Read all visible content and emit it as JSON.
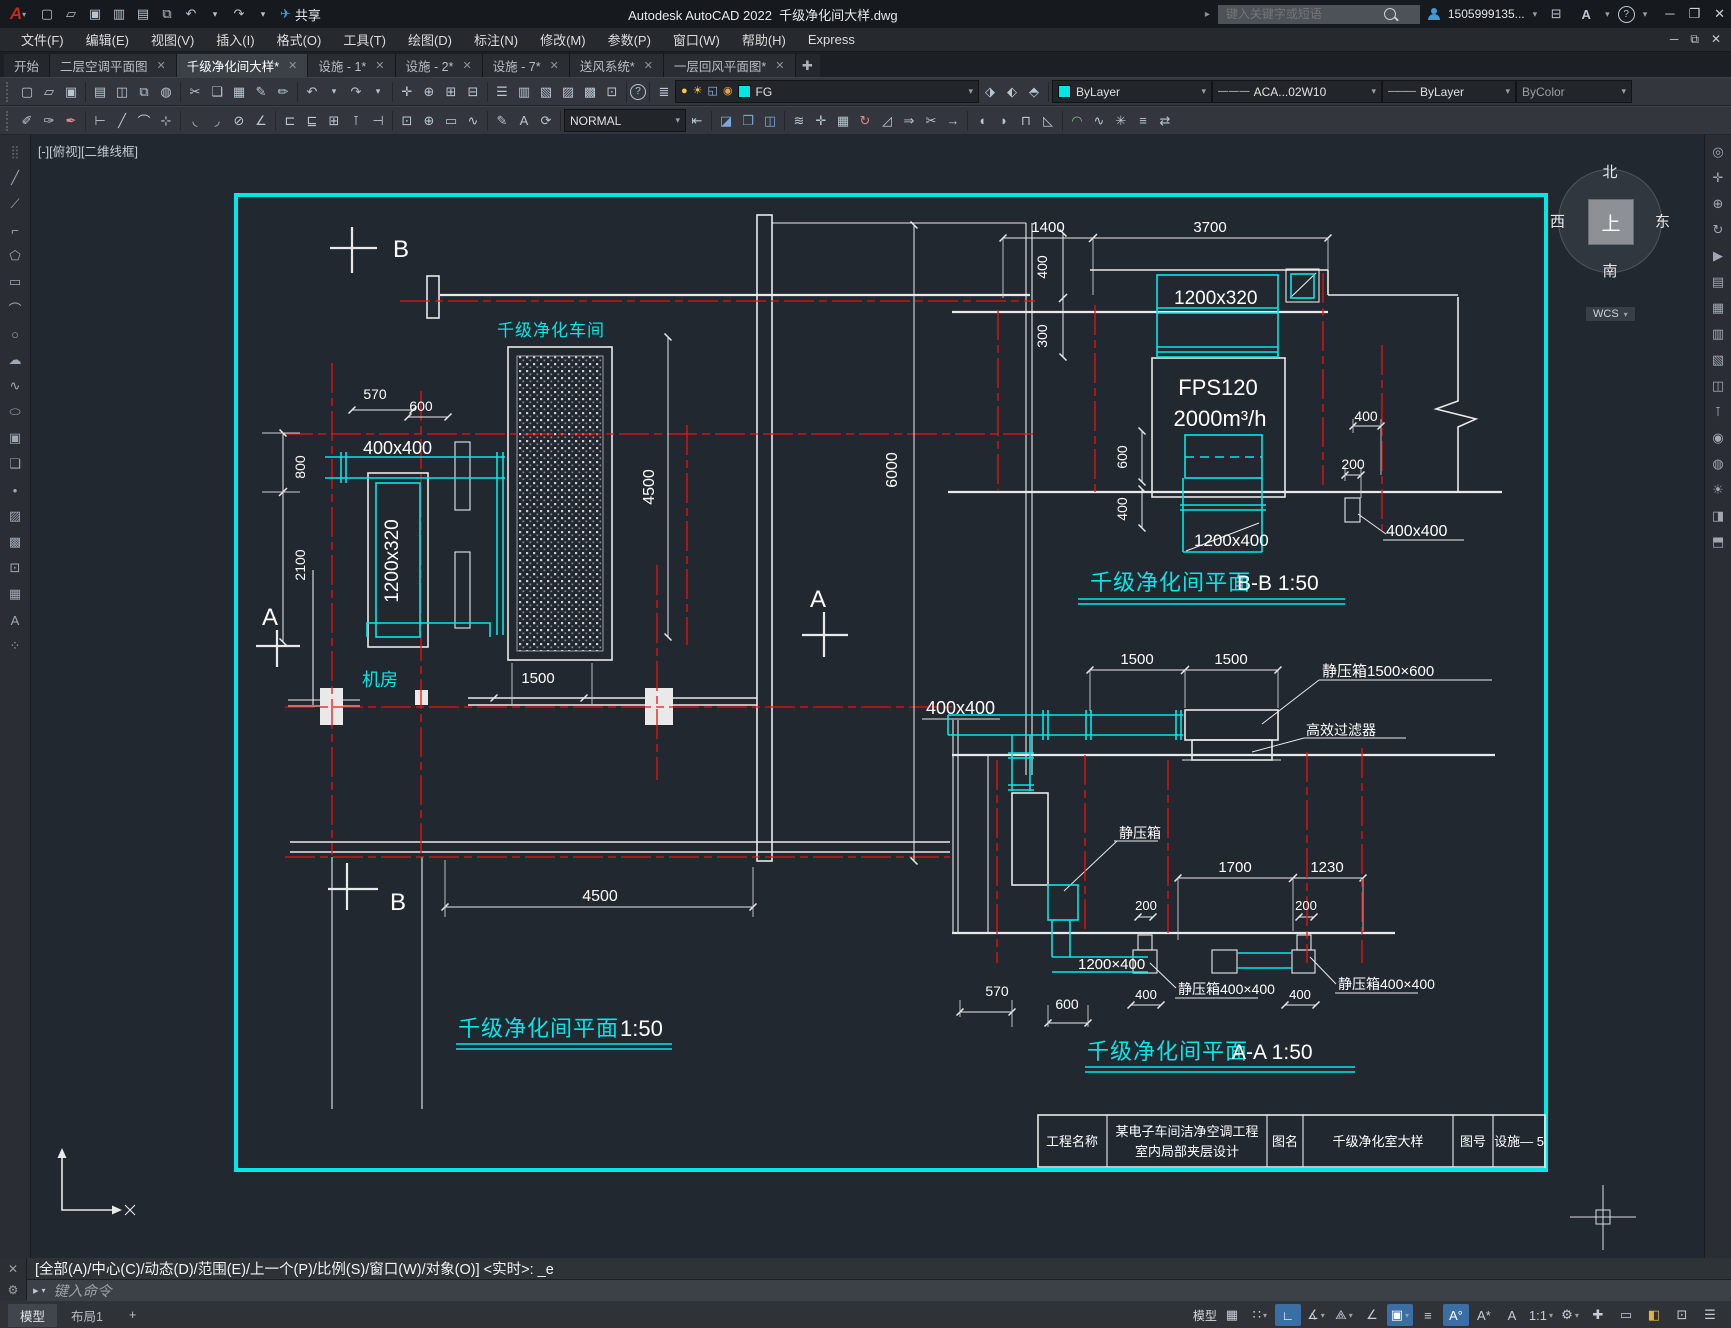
{
  "titlebar": {
    "app_title": "Autodesk AutoCAD 2022",
    "doc_title": "千级净化间大样.dwg",
    "share_label": "共享",
    "search_placeholder": "键入关键字或短语",
    "user_id": "1505999135..."
  },
  "menubar": {
    "items": [
      "文件(F)",
      "编辑(E)",
      "视图(V)",
      "插入(I)",
      "格式(O)",
      "工具(T)",
      "绘图(D)",
      "标注(N)",
      "修改(M)",
      "参数(P)",
      "窗口(W)",
      "帮助(H)",
      "Express"
    ]
  },
  "filetabs": {
    "tabs": [
      {
        "label": "开始"
      },
      {
        "label": "二层空调平面图"
      },
      {
        "label": "千级净化间大样*"
      },
      {
        "label": "设施 - 1*"
      },
      {
        "label": "设施 - 2*"
      },
      {
        "label": "设施 - 7*"
      },
      {
        "label": "送风系统*"
      },
      {
        "label": "一层回风平面图*"
      }
    ]
  },
  "ribbon": {
    "layer_name": "FG",
    "color": "ByLayer",
    "linetype": "ACA...02W10",
    "lineweight": "ByLayer",
    "plot_style": "ByColor",
    "dim_style": "NORMAL"
  },
  "icons": {
    "quick_access": [
      "qnew",
      "open",
      "save",
      "save-as",
      "plot",
      "undo",
      "redo",
      "share"
    ],
    "toolbar1": [
      "qnew",
      "open",
      "save",
      "plot",
      "plot-preview",
      "publish",
      "etransmit",
      "cut",
      "copy",
      "paste",
      "match-properties",
      "block-editor",
      "undo",
      "redo",
      "pan",
      "zoom-realtime",
      "zoom-window",
      "zoom-previous",
      "properties",
      "design-center",
      "tool-palettes",
      "sheet-set-manager",
      "markup-set-manager",
      "quickcalc",
      "help",
      "layer-properties",
      "layer-off",
      "layer-states",
      "layer-walk",
      "layer-bulb",
      "layer-sun",
      "layer-lock"
    ],
    "toolbar2": [
      "dim-update",
      "dim-style",
      "dim-override",
      "linear-dimension",
      "aligned-dimension",
      "arc-length-dimension",
      "ordinate-dimension",
      "radius-dimension",
      "diameter-dimension",
      "angular-dimension",
      "quick-dimension",
      "baseline-dimension",
      "continue-dimension",
      "dimension-break",
      "tolerance",
      "center-mark",
      "jogged-dimension",
      "dimension-edit",
      "dimension-text-edit",
      "erase",
      "copy",
      "mirror",
      "offset",
      "array",
      "move",
      "rotate",
      "scale",
      "stretch",
      "trim",
      "extend",
      "break",
      "join",
      "chamfer",
      "fillet",
      "explode",
      "align"
    ],
    "left_strip": [
      "line",
      "construction-line",
      "polyline",
      "polygon",
      "rectangle",
      "arc",
      "circle",
      "revision-cloud",
      "spline",
      "ellipse",
      "insert-block",
      "create-block",
      "point",
      "hatch",
      "gradient",
      "region",
      "table",
      "mtext"
    ],
    "right_strip": [
      "full-nav-wheel",
      "pan-hand",
      "zoom-lens",
      "orbit",
      "showmotion",
      "sheet",
      "grid-panel",
      "list-panel",
      "layers",
      "split",
      "measure",
      "camera",
      "render",
      "sun",
      "section",
      "styles"
    ],
    "statusbar": [
      "grid",
      "snap",
      "ortho",
      "polar-tracking",
      "isodraft",
      "object-snap-tracking",
      "object-snap",
      "lineweight",
      "annotation-visibility",
      "autoscale",
      "annotation",
      "workspace-gear",
      "plus",
      "isolate",
      "hardware-acceleration",
      "fullscreen",
      "customization-menu"
    ]
  },
  "viewport": {
    "label": "[-][俯视][二维线框]"
  },
  "viewcube": {
    "north": "北",
    "south": "南",
    "west": "西",
    "east": "东",
    "top": "上",
    "wcs": "WCS"
  },
  "drawing": {
    "plan": {
      "room": "千级净化车间",
      "machine_room": "机房",
      "marker_b": "B",
      "marker_a": "A",
      "d570": "570",
      "d600": "600",
      "d400x400": "400x400",
      "d800": "800",
      "d2100": "2100",
      "duct": "1200x320",
      "d1500": "1500",
      "v4500": "4500",
      "v6000": "6000",
      "b4500": "4500",
      "title": "千级净化间平面",
      "scale": "1:50"
    },
    "bb": {
      "d1400": "1400",
      "d3700": "3700",
      "d400t": "400",
      "d300": "300",
      "duct_top": "1200x320",
      "fan_model": "FPS120",
      "airflow": "2000m³/h",
      "d600": "600",
      "d400l": "400",
      "duct_bottom": "1200x400",
      "d400r": "400",
      "d200": "200",
      "outlet": "400x400",
      "title": "千级净化间平面",
      "suffix": "B-B 1:50"
    },
    "aa": {
      "duct": "400x400",
      "d1500a": "1500",
      "d1500b": "1500",
      "plenum_top": "静压箱1500×600",
      "filter": "高效过滤器",
      "plenum_mid": "静压箱",
      "d1700": "1700",
      "d1230": "1230",
      "d200a": "200",
      "d200b": "200",
      "duct2": "1200×400",
      "plenum_a": "静压箱400×400",
      "plenum_b": "静压箱400×400",
      "d400a": "400",
      "d400b": "400",
      "d570": "570",
      "d600": "600",
      "title": "千级净化间平面",
      "suffix": "A-A 1:50"
    },
    "titleblock": {
      "f1": "工程名称",
      "project1": "某电子车间洁净空调工程",
      "project2": "室内局部夹层设计",
      "f2": "图名",
      "name": "千级净化室大样",
      "f3": "图号",
      "number": "设施— 5"
    }
  },
  "commandline": {
    "history": "[全部(A)/中心(C)/动态(D)/范围(E)/上一个(P)/比例(S)/窗口(W)/对象(O)] <实时>: _e",
    "placeholder": "键入命令"
  },
  "statusbar": {
    "model_tab": "模型",
    "layout_tab": "布局1",
    "new_layout": "+",
    "model_button": "模型",
    "annotation_scale": "1:1"
  }
}
